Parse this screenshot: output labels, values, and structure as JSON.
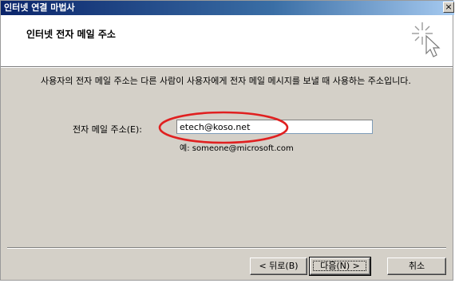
{
  "window": {
    "title": "인터넷 연결 마법사",
    "close_glyph": "×"
  },
  "header": {
    "title": "인터넷 전자 메일 주소"
  },
  "body": {
    "description": "사용자의 전자 메일 주소는 다른 사람이 사용자에게 전자 메일 메시지를 보낼 때 사용하는 주소입니다.",
    "email_label": "전자 메일 주소(E):",
    "email_value": "etech@koso.net",
    "example": "예: someone@microsoft.com"
  },
  "buttons": {
    "back": "< 뒤로(B)",
    "next": "다음(N) >",
    "cancel": "취소"
  },
  "colors": {
    "annotation": "#e02020",
    "titlebar_start": "#0a246a",
    "dialog_bg": "#d4d0c8"
  },
  "icons": {
    "header": "wizard-sparkle-cursor-icon",
    "close": "close-icon"
  }
}
